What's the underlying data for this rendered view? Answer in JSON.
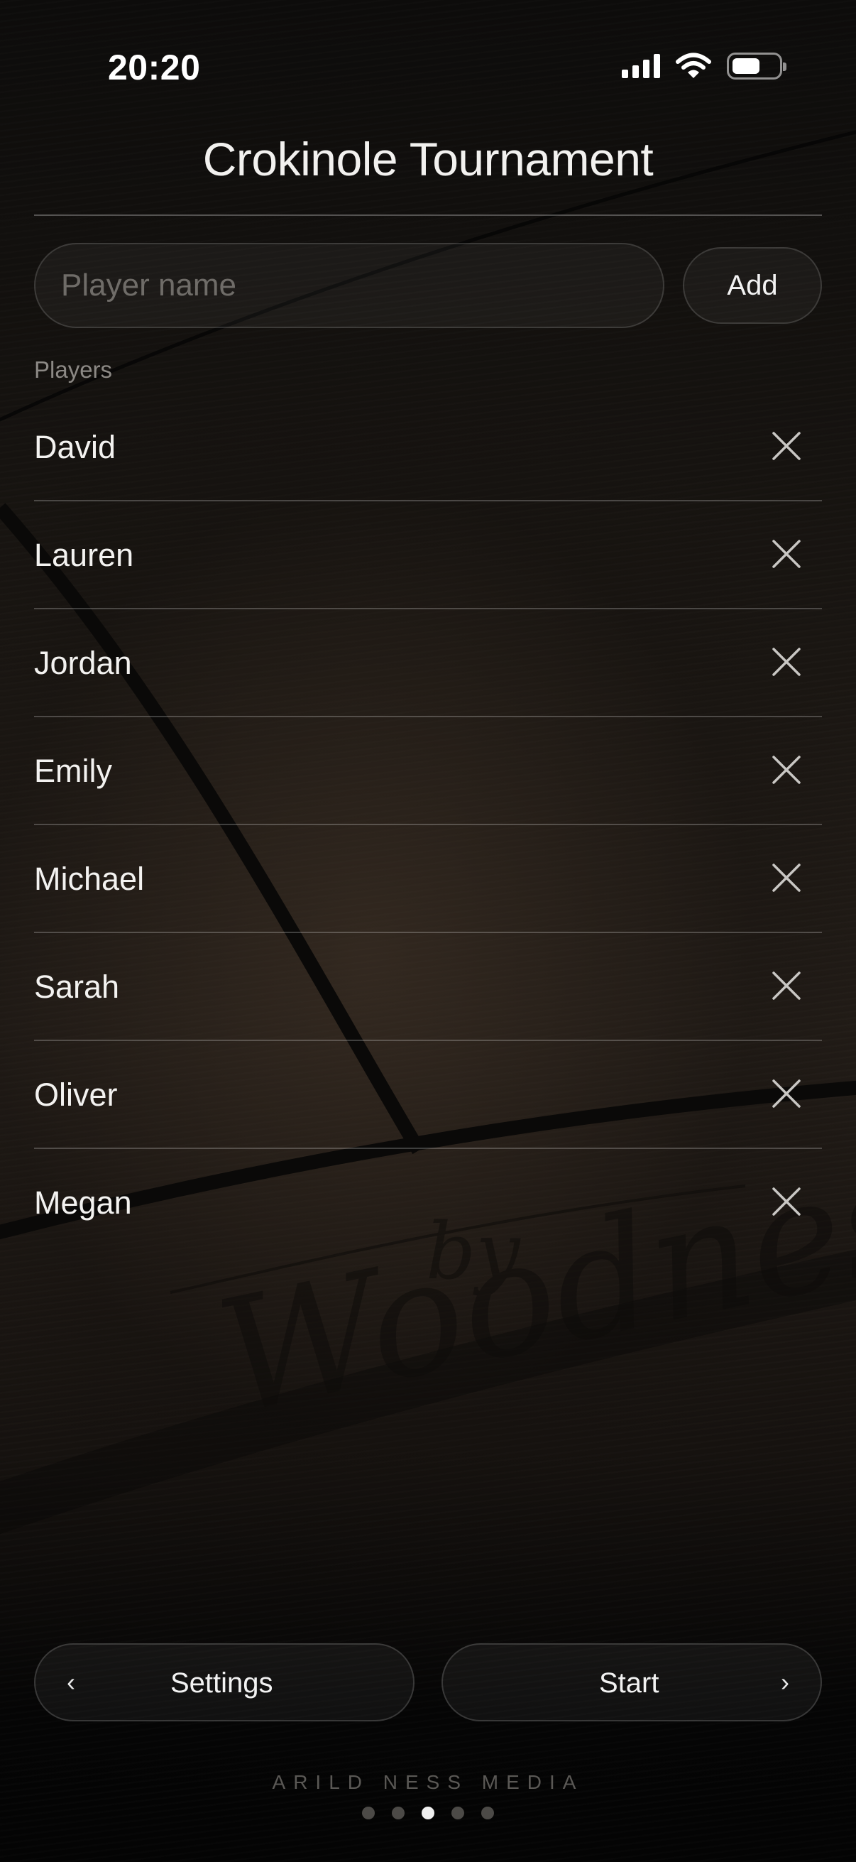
{
  "status_bar": {
    "time": "20:20"
  },
  "header": {
    "title": "Crokinole Tournament"
  },
  "add_player": {
    "placeholder": "Player name",
    "value": "",
    "add_label": "Add"
  },
  "players_section": {
    "label": "Players",
    "players": [
      "David",
      "Lauren",
      "Jordan",
      "Emily",
      "Michael",
      "Sarah",
      "Oliver",
      "Megan"
    ]
  },
  "remove_icon": "close-icon",
  "navigation": {
    "back_chevron": "‹",
    "back_label": "Settings",
    "next_label": "Start",
    "next_chevron": "›"
  },
  "watermark": {
    "line1": "by",
    "line2": "Woodness"
  },
  "footer": {
    "brand": "ARILD NESS MEDIA"
  },
  "pagination": {
    "total": 5,
    "current": 3
  },
  "colors": {
    "background": "#0b0a09",
    "text": "#ecebe9",
    "muted": "#8c8985",
    "divider": "rgba(255,255,255,0.22)"
  }
}
